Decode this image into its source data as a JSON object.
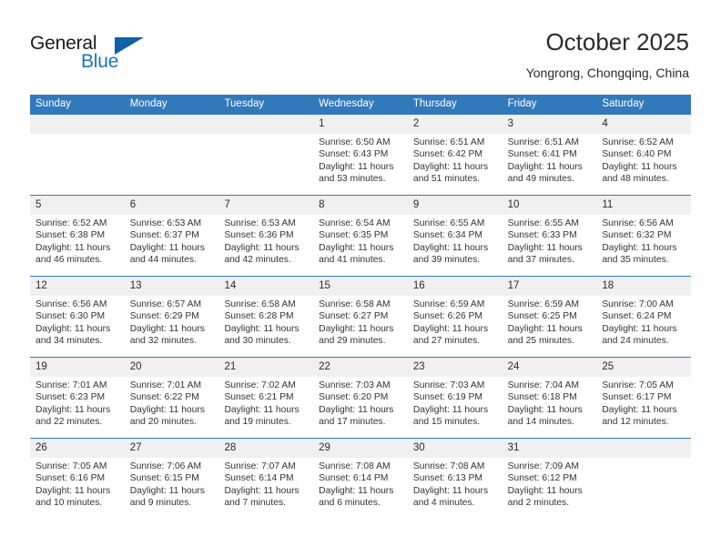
{
  "brand": {
    "name_part1": "General",
    "name_part2": "Blue",
    "triangle_icon": "triangle-icon",
    "accent_color": "#1061a8",
    "blue_text_color": "#1878be"
  },
  "header": {
    "title": "October 2025",
    "subtitle": "Yongrong, Chongqing, China"
  },
  "calendar": {
    "header_bg": "#3279bb",
    "number_band_bg": "#f0f0f0",
    "weekdays": [
      "Sunday",
      "Monday",
      "Tuesday",
      "Wednesday",
      "Thursday",
      "Friday",
      "Saturday"
    ],
    "weeks": [
      [
        {
          "day": "",
          "sunrise": "",
          "sunset": "",
          "daylight": "",
          "daylight2": ""
        },
        {
          "day": "",
          "sunrise": "",
          "sunset": "",
          "daylight": "",
          "daylight2": ""
        },
        {
          "day": "",
          "sunrise": "",
          "sunset": "",
          "daylight": "",
          "daylight2": ""
        },
        {
          "day": "1",
          "sunrise": "Sunrise: 6:50 AM",
          "sunset": "Sunset: 6:43 PM",
          "daylight": "Daylight: 11 hours",
          "daylight2": "and 53 minutes."
        },
        {
          "day": "2",
          "sunrise": "Sunrise: 6:51 AM",
          "sunset": "Sunset: 6:42 PM",
          "daylight": "Daylight: 11 hours",
          "daylight2": "and 51 minutes."
        },
        {
          "day": "3",
          "sunrise": "Sunrise: 6:51 AM",
          "sunset": "Sunset: 6:41 PM",
          "daylight": "Daylight: 11 hours",
          "daylight2": "and 49 minutes."
        },
        {
          "day": "4",
          "sunrise": "Sunrise: 6:52 AM",
          "sunset": "Sunset: 6:40 PM",
          "daylight": "Daylight: 11 hours",
          "daylight2": "and 48 minutes."
        }
      ],
      [
        {
          "day": "5",
          "sunrise": "Sunrise: 6:52 AM",
          "sunset": "Sunset: 6:38 PM",
          "daylight": "Daylight: 11 hours",
          "daylight2": "and 46 minutes."
        },
        {
          "day": "6",
          "sunrise": "Sunrise: 6:53 AM",
          "sunset": "Sunset: 6:37 PM",
          "daylight": "Daylight: 11 hours",
          "daylight2": "and 44 minutes."
        },
        {
          "day": "7",
          "sunrise": "Sunrise: 6:53 AM",
          "sunset": "Sunset: 6:36 PM",
          "daylight": "Daylight: 11 hours",
          "daylight2": "and 42 minutes."
        },
        {
          "day": "8",
          "sunrise": "Sunrise: 6:54 AM",
          "sunset": "Sunset: 6:35 PM",
          "daylight": "Daylight: 11 hours",
          "daylight2": "and 41 minutes."
        },
        {
          "day": "9",
          "sunrise": "Sunrise: 6:55 AM",
          "sunset": "Sunset: 6:34 PM",
          "daylight": "Daylight: 11 hours",
          "daylight2": "and 39 minutes."
        },
        {
          "day": "10",
          "sunrise": "Sunrise: 6:55 AM",
          "sunset": "Sunset: 6:33 PM",
          "daylight": "Daylight: 11 hours",
          "daylight2": "and 37 minutes."
        },
        {
          "day": "11",
          "sunrise": "Sunrise: 6:56 AM",
          "sunset": "Sunset: 6:32 PM",
          "daylight": "Daylight: 11 hours",
          "daylight2": "and 35 minutes."
        }
      ],
      [
        {
          "day": "12",
          "sunrise": "Sunrise: 6:56 AM",
          "sunset": "Sunset: 6:30 PM",
          "daylight": "Daylight: 11 hours",
          "daylight2": "and 34 minutes."
        },
        {
          "day": "13",
          "sunrise": "Sunrise: 6:57 AM",
          "sunset": "Sunset: 6:29 PM",
          "daylight": "Daylight: 11 hours",
          "daylight2": "and 32 minutes."
        },
        {
          "day": "14",
          "sunrise": "Sunrise: 6:58 AM",
          "sunset": "Sunset: 6:28 PM",
          "daylight": "Daylight: 11 hours",
          "daylight2": "and 30 minutes."
        },
        {
          "day": "15",
          "sunrise": "Sunrise: 6:58 AM",
          "sunset": "Sunset: 6:27 PM",
          "daylight": "Daylight: 11 hours",
          "daylight2": "and 29 minutes."
        },
        {
          "day": "16",
          "sunrise": "Sunrise: 6:59 AM",
          "sunset": "Sunset: 6:26 PM",
          "daylight": "Daylight: 11 hours",
          "daylight2": "and 27 minutes."
        },
        {
          "day": "17",
          "sunrise": "Sunrise: 6:59 AM",
          "sunset": "Sunset: 6:25 PM",
          "daylight": "Daylight: 11 hours",
          "daylight2": "and 25 minutes."
        },
        {
          "day": "18",
          "sunrise": "Sunrise: 7:00 AM",
          "sunset": "Sunset: 6:24 PM",
          "daylight": "Daylight: 11 hours",
          "daylight2": "and 24 minutes."
        }
      ],
      [
        {
          "day": "19",
          "sunrise": "Sunrise: 7:01 AM",
          "sunset": "Sunset: 6:23 PM",
          "daylight": "Daylight: 11 hours",
          "daylight2": "and 22 minutes."
        },
        {
          "day": "20",
          "sunrise": "Sunrise: 7:01 AM",
          "sunset": "Sunset: 6:22 PM",
          "daylight": "Daylight: 11 hours",
          "daylight2": "and 20 minutes."
        },
        {
          "day": "21",
          "sunrise": "Sunrise: 7:02 AM",
          "sunset": "Sunset: 6:21 PM",
          "daylight": "Daylight: 11 hours",
          "daylight2": "and 19 minutes."
        },
        {
          "day": "22",
          "sunrise": "Sunrise: 7:03 AM",
          "sunset": "Sunset: 6:20 PM",
          "daylight": "Daylight: 11 hours",
          "daylight2": "and 17 minutes."
        },
        {
          "day": "23",
          "sunrise": "Sunrise: 7:03 AM",
          "sunset": "Sunset: 6:19 PM",
          "daylight": "Daylight: 11 hours",
          "daylight2": "and 15 minutes."
        },
        {
          "day": "24",
          "sunrise": "Sunrise: 7:04 AM",
          "sunset": "Sunset: 6:18 PM",
          "daylight": "Daylight: 11 hours",
          "daylight2": "and 14 minutes."
        },
        {
          "day": "25",
          "sunrise": "Sunrise: 7:05 AM",
          "sunset": "Sunset: 6:17 PM",
          "daylight": "Daylight: 11 hours",
          "daylight2": "and 12 minutes."
        }
      ],
      [
        {
          "day": "26",
          "sunrise": "Sunrise: 7:05 AM",
          "sunset": "Sunset: 6:16 PM",
          "daylight": "Daylight: 11 hours",
          "daylight2": "and 10 minutes."
        },
        {
          "day": "27",
          "sunrise": "Sunrise: 7:06 AM",
          "sunset": "Sunset: 6:15 PM",
          "daylight": "Daylight: 11 hours",
          "daylight2": "and 9 minutes."
        },
        {
          "day": "28",
          "sunrise": "Sunrise: 7:07 AM",
          "sunset": "Sunset: 6:14 PM",
          "daylight": "Daylight: 11 hours",
          "daylight2": "and 7 minutes."
        },
        {
          "day": "29",
          "sunrise": "Sunrise: 7:08 AM",
          "sunset": "Sunset: 6:14 PM",
          "daylight": "Daylight: 11 hours",
          "daylight2": "and 6 minutes."
        },
        {
          "day": "30",
          "sunrise": "Sunrise: 7:08 AM",
          "sunset": "Sunset: 6:13 PM",
          "daylight": "Daylight: 11 hours",
          "daylight2": "and 4 minutes."
        },
        {
          "day": "31",
          "sunrise": "Sunrise: 7:09 AM",
          "sunset": "Sunset: 6:12 PM",
          "daylight": "Daylight: 11 hours",
          "daylight2": "and 2 minutes."
        },
        {
          "day": "",
          "sunrise": "",
          "sunset": "",
          "daylight": "",
          "daylight2": ""
        }
      ]
    ]
  }
}
